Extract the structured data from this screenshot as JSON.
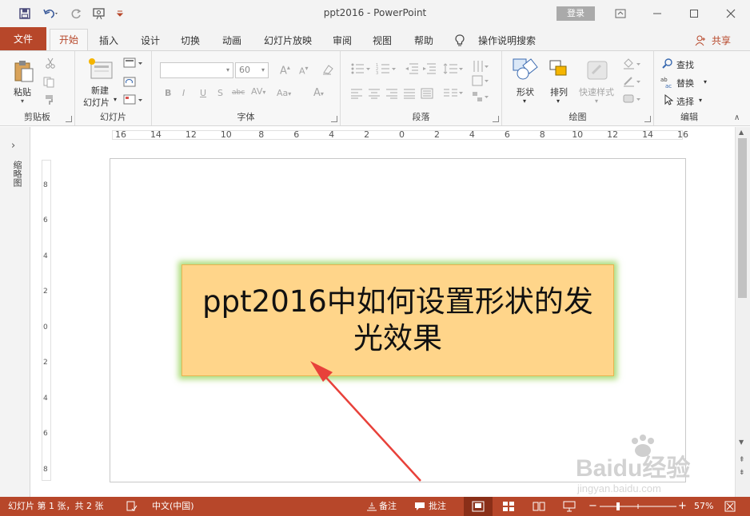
{
  "titlebar": {
    "title": "ppt2016  -  PowerPoint",
    "signin": "登录"
  },
  "tabs": [
    "文件",
    "开始",
    "插入",
    "设计",
    "切换",
    "动画",
    "幻灯片放映",
    "审阅",
    "视图",
    "帮助"
  ],
  "tell_me": "操作说明搜索",
  "share": "共享",
  "ribbon": {
    "clipboard": {
      "label": "剪贴板",
      "paste": "粘贴"
    },
    "slides": {
      "label": "幻灯片",
      "new_slide_line1": "新建",
      "new_slide_line2": "幻灯片"
    },
    "font": {
      "label": "字体",
      "font_size": "60"
    },
    "paragraph": {
      "label": "段落"
    },
    "drawing": {
      "label": "绘图",
      "shapes": "形状",
      "arrange": "排列",
      "quick_styles": "快速样式"
    },
    "editing": {
      "label": "编辑",
      "find": "查找",
      "replace": "替换",
      "select": "选择"
    }
  },
  "left_pane": {
    "thumbnail_label": "缩略图"
  },
  "ruler": {
    "h_ticks": [
      "16",
      "14",
      "12",
      "10",
      "8",
      "6",
      "4",
      "2",
      "0",
      "2",
      "4",
      "6",
      "8",
      "10",
      "12",
      "14",
      "16"
    ],
    "v_ticks": [
      "8",
      "6",
      "4",
      "2",
      "0",
      "2",
      "4",
      "6",
      "8"
    ]
  },
  "slide": {
    "shape_text": "ppt2016中如何设置形状的发光效果",
    "shape_fill": "#ffd58a",
    "glow_color": "#92d050",
    "arrow_color": "#e8413a"
  },
  "statusbar": {
    "slide_info": "幻灯片 第 1 张，共 2 张",
    "language": "中文(中国)",
    "notes": "备注",
    "comments": "批注",
    "zoom": "57%"
  },
  "watermark": {
    "brand": "Baidu经验",
    "url": "jingyan.baidu.com"
  },
  "colors": {
    "accent": "#b7472a"
  }
}
